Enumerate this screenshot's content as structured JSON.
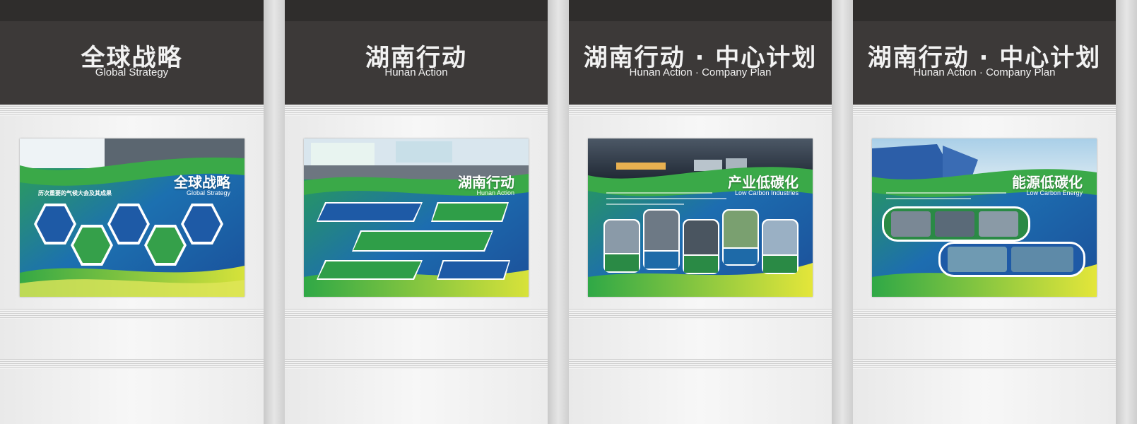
{
  "panels": [
    {
      "title_cn": "全球战略",
      "title_en": "Global Strategy",
      "board_title_cn": "全球战略",
      "board_title_en": "Global Strategy",
      "board_subtitle": "历次重要的气候大会及其成果"
    },
    {
      "title_cn": "湖南行动",
      "title_en": "Hunan Action",
      "board_title_cn": "湖南行动",
      "board_title_en": "Hunan Action"
    },
    {
      "title_cn": "湖南行动 · 中心计划",
      "title_en": "Hunan Action · Company Plan",
      "board_title_cn": "产业低碳化",
      "board_title_en": "Low Carbon Industries"
    },
    {
      "title_cn": "湖南行动 · 中心计划",
      "title_en": "Hunan Action · Company Plan",
      "board_title_cn": "能源低碳化",
      "board_title_en": "Low Carbon Energy"
    }
  ],
  "colors": {
    "header": "#3c3938",
    "board_blue": "#1d63a8",
    "board_green": "#2fa64a",
    "accent_yellow": "#d8e23a"
  }
}
